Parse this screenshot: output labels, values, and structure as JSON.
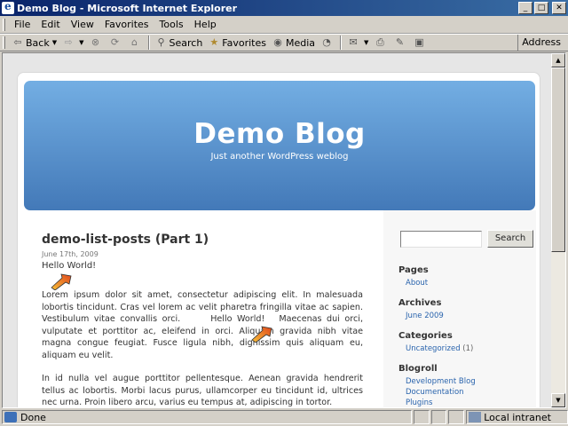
{
  "window": {
    "title": "Demo Blog - Microsoft Internet Explorer"
  },
  "menu": [
    "File",
    "Edit",
    "View",
    "Favorites",
    "Tools",
    "Help"
  ],
  "toolbar": {
    "back_label": "Back",
    "search_label": "Search",
    "favorites_label": "Favorites",
    "media_label": "Media",
    "address_label": "Address"
  },
  "blog": {
    "title": "Demo Blog",
    "description": "Just another WordPress weblog"
  },
  "post": {
    "title": "demo-list-posts (Part 1)",
    "date": "June 17th, 2009",
    "hello": "Hello World!",
    "para1_start": "Lorem ipsum dolor sit amet, consectetur adipiscing elit. In malesuada lobortis tincidunt. Cras vel lorem ac velit pharetra fringilla vitae ac sapien. Vestibulum vitae convallis orci.",
    "para1_hello": "Hello World!",
    "para1_end": "Maecenas dui orci, vulputate et porttitor ac, eleifend in orci. Aliquam gravida nibh vitae magna congue feugiat. Fusce ligula nibh, dignissim quis aliquam eu, aliquam eu velit.",
    "para2": "In id nulla vel augue porttitor pellentesque. Aenean gravida hendrerit tellus ac lobortis. Morbi lacus purus, ullamcorper eu tincidunt id, ultrices nec urna. Proin libero arcu, varius eu tempus at, adipiscing in tortor."
  },
  "sidebar": {
    "search_button": "Search",
    "pages": {
      "heading": "Pages",
      "links": [
        "About"
      ]
    },
    "archives": {
      "heading": "Archives",
      "links": [
        "June 2009"
      ]
    },
    "categories": {
      "heading": "Categories",
      "link": "Uncategorized",
      "count": "(1)"
    },
    "blogroll": {
      "heading": "Blogroll",
      "links": [
        "Development Blog",
        "Documentation",
        "Plugins"
      ]
    }
  },
  "status": {
    "text": "Done",
    "zone": "Local intranet"
  }
}
